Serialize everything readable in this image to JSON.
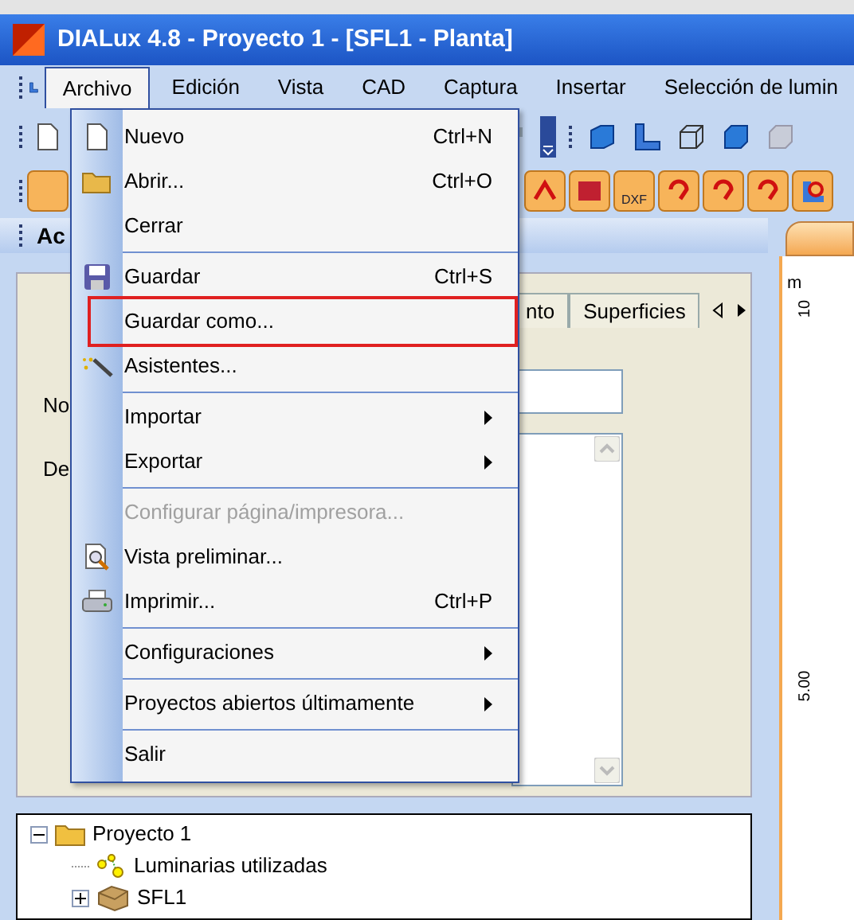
{
  "window": {
    "title": "DIALux 4.8 - Proyecto 1 - [SFL1 - Planta]"
  },
  "menu_bar": [
    {
      "label": "Archivo",
      "selected": true
    },
    {
      "label": "Edición",
      "selected": false
    },
    {
      "label": "Vista",
      "selected": false
    },
    {
      "label": "CAD",
      "selected": false
    },
    {
      "label": "Captura",
      "selected": false
    },
    {
      "label": "Insertar",
      "selected": false
    },
    {
      "label": "Selección de lumin",
      "selected": false
    }
  ],
  "file_menu": [
    {
      "kind": "item",
      "label": "Nuevo",
      "shortcut": "Ctrl+N",
      "submenu": false,
      "disabled": false,
      "annotated": false
    },
    {
      "kind": "item",
      "label": "Abrir...",
      "shortcut": "Ctrl+O",
      "submenu": false,
      "disabled": false,
      "annotated": false
    },
    {
      "kind": "item",
      "label": "Cerrar",
      "submenu": false,
      "disabled": false,
      "annotated": false
    },
    {
      "kind": "separator"
    },
    {
      "kind": "item",
      "label": "Guardar",
      "shortcut": "Ctrl+S",
      "submenu": false,
      "disabled": false,
      "annotated": false
    },
    {
      "kind": "item",
      "label": "Guardar como...",
      "submenu": false,
      "disabled": false,
      "annotated": true
    },
    {
      "kind": "item",
      "label": "Asistentes...",
      "submenu": false,
      "disabled": false,
      "annotated": false
    },
    {
      "kind": "separator"
    },
    {
      "kind": "item",
      "label": "Importar",
      "submenu": true,
      "disabled": false,
      "annotated": false
    },
    {
      "kind": "item",
      "label": "Exportar",
      "submenu": true,
      "disabled": false,
      "annotated": false
    },
    {
      "kind": "separator"
    },
    {
      "kind": "item",
      "label": "Configurar página/impresora...",
      "submenu": false,
      "disabled": true,
      "annotated": false
    },
    {
      "kind": "item",
      "label": "Vista preliminar...",
      "submenu": false,
      "disabled": false,
      "annotated": false
    },
    {
      "kind": "item",
      "label": "Imprimir...",
      "shortcut": "Ctrl+P",
      "submenu": false,
      "disabled": false,
      "annotated": false
    },
    {
      "kind": "separator"
    },
    {
      "kind": "item",
      "label": "Configuraciones",
      "submenu": true,
      "disabled": false,
      "annotated": false
    },
    {
      "kind": "separator"
    },
    {
      "kind": "item",
      "label": "Proyectos abiertos últimamente",
      "submenu": true,
      "disabled": false,
      "annotated": false
    },
    {
      "kind": "separator"
    },
    {
      "kind": "item",
      "label": "Salir",
      "submenu": false,
      "disabled": false,
      "annotated": false
    }
  ],
  "toolbar": {
    "dxf_label": "DXF"
  },
  "panel": {
    "title": "Ac",
    "tabs": [
      {
        "label": "nto",
        "selected": false
      },
      {
        "label": "Superficies",
        "selected": false
      }
    ],
    "labels": [
      "No",
      "De"
    ]
  },
  "tree": [
    {
      "label": "Proyecto 1",
      "expanded": true,
      "children": [
        {
          "label": "Luminarias utilizadas"
        },
        {
          "label": "SFL1",
          "expanded": false
        }
      ]
    }
  ],
  "view": {
    "unit": "m",
    "ticks": [
      "10",
      "5.00"
    ]
  }
}
